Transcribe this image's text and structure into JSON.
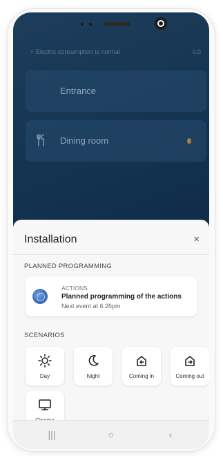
{
  "background": {
    "consumption_text": "⚡ Electric consumption is normal",
    "consumption_value": "0,0",
    "rooms": [
      {
        "label": "Entrance"
      },
      {
        "label": "Dining room"
      }
    ]
  },
  "sheet": {
    "title": "Installation",
    "close_icon": "×",
    "planned_section": "PLANNED PROGRAMMING",
    "action": {
      "kicker": "ACTIONS",
      "title": "Planned programming of the actions",
      "subtitle": "Next event at 6.26pm"
    },
    "scenarios_section": "SCENARIOS",
    "scenarios": [
      {
        "label": "Day",
        "icon": "sun-icon"
      },
      {
        "label": "Night",
        "icon": "moon-icon"
      },
      {
        "label": "Coming in",
        "icon": "home-enter-icon"
      },
      {
        "label": "Coming out",
        "icon": "home-exit-icon"
      },
      {
        "label": "Cinema",
        "icon": "monitor-icon"
      }
    ]
  },
  "navbar": {
    "recents": "|||",
    "home": "○",
    "back": "‹"
  }
}
